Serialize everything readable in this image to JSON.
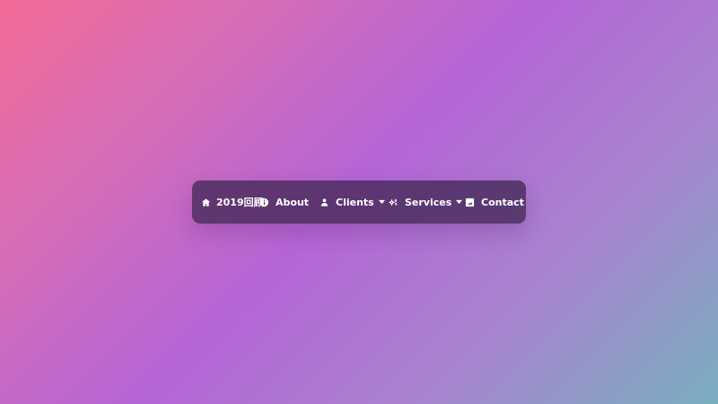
{
  "nav": {
    "home_label": "2019回顾",
    "about_label": "About",
    "clients_label": "Clients",
    "services_label": "Services",
    "contact_label": "Contact",
    "icons": {
      "home": "home-icon",
      "about": "info-icon",
      "clients": "user-icon",
      "services": "gears-icon",
      "contact": "contact-card-icon",
      "dropdown": "caret-down-icon"
    },
    "colors": {
      "bar_background": "#432856",
      "text": "#ffffff"
    }
  },
  "background": {
    "gradient_colors": [
      "#f36b96",
      "#b565d6",
      "#7aaec0"
    ]
  }
}
